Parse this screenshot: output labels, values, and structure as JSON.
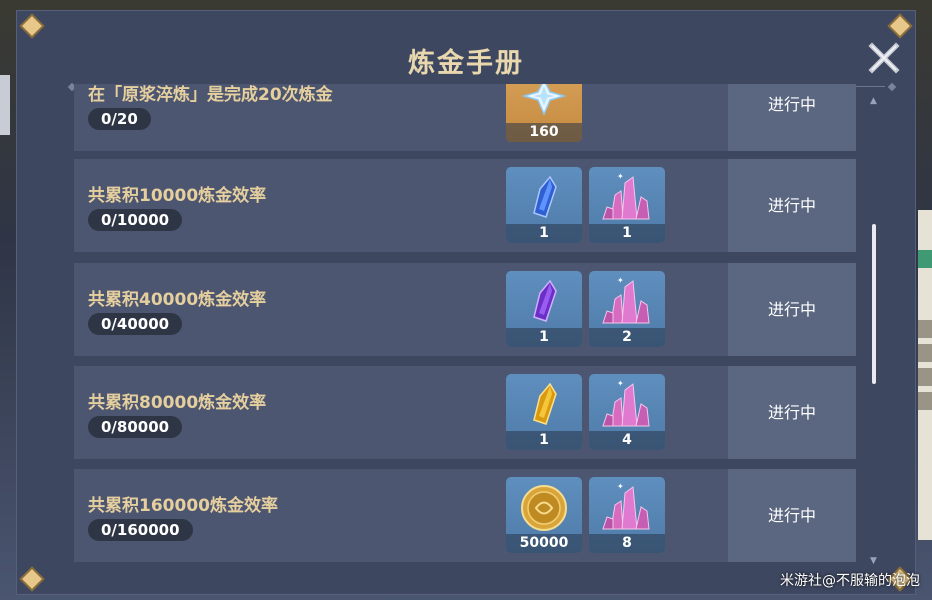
{
  "title": "炼金手册",
  "status_label": "进行中",
  "watermark": "米游社@不服输的泡泡",
  "rows": [
    {
      "name": "在「原浆淬炼」是完成20次炼金",
      "progress": "0/20",
      "rewards": [
        {
          "icon": "primogem-icon",
          "qty": "160"
        }
      ]
    },
    {
      "name": "共累积10000炼金效率",
      "progress": "0/10000",
      "rewards": [
        {
          "icon": "blue-crystal-icon",
          "qty": "1"
        },
        {
          "icon": "pink-crystal-cluster-icon",
          "qty": "1"
        }
      ]
    },
    {
      "name": "共累积40000炼金效率",
      "progress": "0/40000",
      "rewards": [
        {
          "icon": "purple-crystal-icon",
          "qty": "1"
        },
        {
          "icon": "pink-crystal-cluster-icon",
          "qty": "2"
        }
      ]
    },
    {
      "name": "共累积80000炼金效率",
      "progress": "0/80000",
      "rewards": [
        {
          "icon": "gold-crystal-icon",
          "qty": "1"
        },
        {
          "icon": "pink-crystal-cluster-icon",
          "qty": "4"
        }
      ]
    },
    {
      "name": "共累积160000炼金效率",
      "progress": "0/160000",
      "rewards": [
        {
          "icon": "mora-coin-icon",
          "qty": "50000"
        },
        {
          "icon": "pink-crystal-cluster-icon",
          "qty": "8"
        }
      ]
    }
  ],
  "colors": {
    "title": "#e9d7ad",
    "row_bg": "#4c5670",
    "status_bg": "#5b6780",
    "reward_bg": "#5f8fbf"
  }
}
